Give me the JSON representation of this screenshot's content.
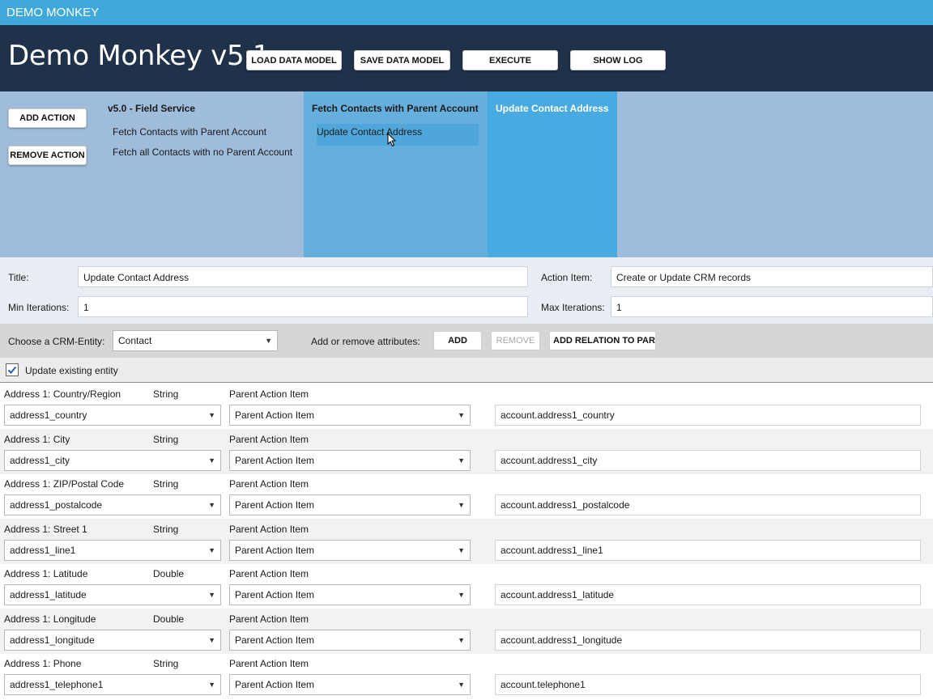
{
  "window": {
    "title": "DEMO MONKEY"
  },
  "header": {
    "app_title": "Demo Monkey v5.1",
    "buttons": [
      "LOAD DATA MODEL",
      "SAVE DATA MODEL",
      "EXECUTE",
      "SHOW LOG"
    ]
  },
  "actions": {
    "add_label": "ADD ACTION",
    "remove_label": "REMOVE ACTION"
  },
  "tree": {
    "root": "v5.0 - Field Service",
    "children": [
      "Fetch Contacts with Parent Account",
      "Fetch all Contacts with no Parent Account"
    ],
    "column2_title": "Fetch Contacts with Parent Account",
    "column2_items": [
      "Update Contact Address"
    ],
    "column3_title": "Update Contact Address"
  },
  "form": {
    "title_label": "Title:",
    "title_value": "Update Contact Address",
    "action_item_label": "Action Item:",
    "action_item_value": "Create or Update CRM records",
    "min_label": "Min Iterations:",
    "min_value": "1",
    "max_label": "Max Iterations:",
    "max_value": "1"
  },
  "entity": {
    "choose_label": "Choose a CRM-Entity:",
    "entity_value": "Contact",
    "attr_label": "Add or remove attributes:",
    "add_label": "ADD",
    "remove_label": "REMOVE",
    "relation_label": "ADD RELATION TO PAREN"
  },
  "update_existing": {
    "label": "Update existing entity",
    "checked": true
  },
  "attributes": [
    {
      "label": "Address 1: Country/Region",
      "type": "String",
      "source_header": "Parent Action Item",
      "field": "address1_country",
      "source": "Parent Action Item",
      "value": "account.address1_country"
    },
    {
      "label": "Address 1: City",
      "type": "String",
      "source_header": "Parent Action Item",
      "field": "address1_city",
      "source": "Parent Action Item",
      "value": "account.address1_city"
    },
    {
      "label": "Address 1: ZIP/Postal Code",
      "type": "String",
      "source_header": "Parent Action Item",
      "field": "address1_postalcode",
      "source": "Parent Action Item",
      "value": "account.address1_postalcode"
    },
    {
      "label": "Address 1: Street 1",
      "type": "String",
      "source_header": "Parent Action Item",
      "field": "address1_line1",
      "source": "Parent Action Item",
      "value": "account.address1_line1"
    },
    {
      "label": "Address 1: Latitude",
      "type": "Double",
      "source_header": "Parent Action Item",
      "field": "address1_latitude",
      "source": "Parent Action Item",
      "value": "account.address1_latitude"
    },
    {
      "label": "Address 1: Longitude",
      "type": "Double",
      "source_header": "Parent Action Item",
      "field": "address1_longitude",
      "source": "Parent Action Item",
      "value": "account.address1_longitude"
    },
    {
      "label": "Address 1: Phone",
      "type": "String",
      "source_header": "Parent Action Item",
      "field": "address1_telephone1",
      "source": "Parent Action Item",
      "value": "account.telephone1"
    }
  ],
  "icons": {
    "dropdown": "chevron-down-icon",
    "check": "check-icon",
    "cursor": "pointer-cursor-icon"
  },
  "colors": {
    "titlebar": "#3fa9dc",
    "header": "#1f3249",
    "panel": "#9fbddb",
    "selected_column": "#47aae0"
  }
}
